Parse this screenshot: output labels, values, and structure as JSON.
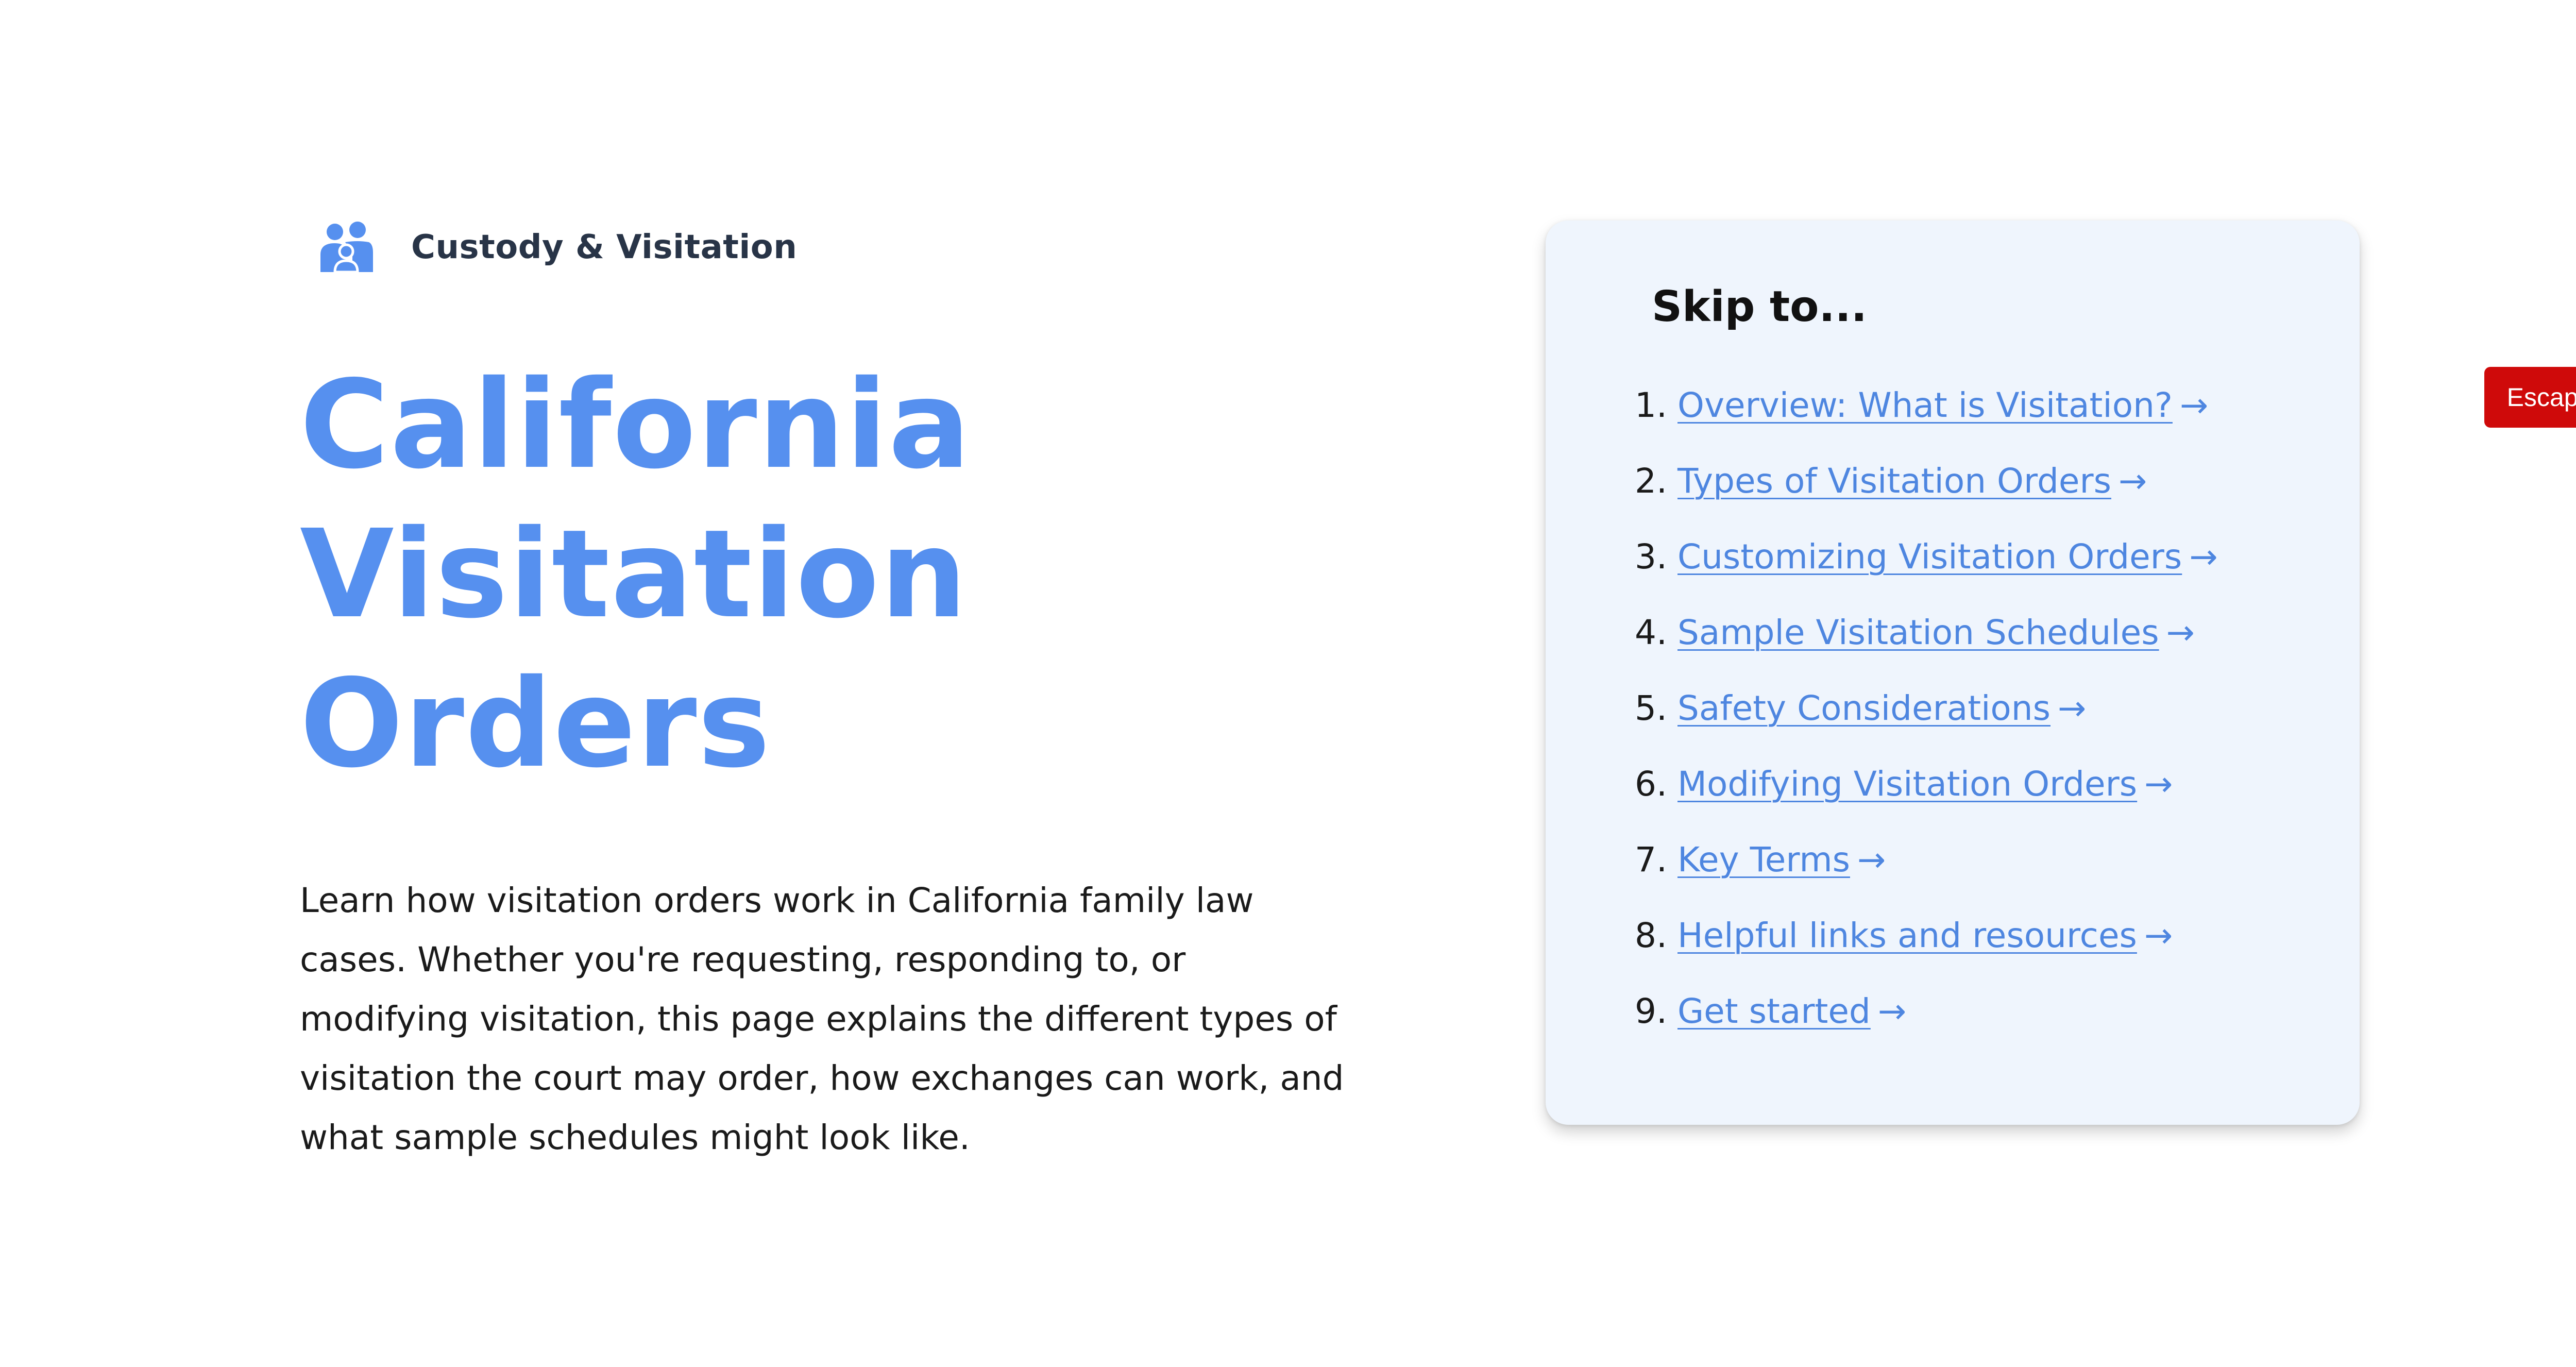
{
  "header": {
    "eyebrow_icon": "family-icon",
    "eyebrow_label": "Custody & Visitation",
    "title_line1": "California",
    "title_line2": "Visitation Orders",
    "lede": "Learn how visitation orders work in California family law cases. Whether you're requesting, responding to, or modifying visitation, this page explains the different types of visitation the court may order, how exchanges can work, and what sample schedules might look like."
  },
  "skip": {
    "heading": "Skip to...",
    "arrow": "→",
    "items": [
      {
        "num": "1.",
        "label": "Overview: What is Visitation?"
      },
      {
        "num": "2.",
        "label": "Types of Visitation Orders"
      },
      {
        "num": "3.",
        "label": "Customizing Visitation Orders"
      },
      {
        "num": "4.",
        "label": "Sample Visitation Schedules"
      },
      {
        "num": "5.",
        "label": "Safety Considerations"
      },
      {
        "num": "6.",
        "label": "Modifying Visitation Orders"
      },
      {
        "num": "7.",
        "label": "Key Terms"
      },
      {
        "num": "8.",
        "label": "Helpful links and resources"
      },
      {
        "num": "9.",
        "label": "Get started"
      }
    ]
  },
  "escape": {
    "label": "Escape"
  },
  "colors": {
    "accent": "#5690ef",
    "link": "#4e86e0",
    "card_bg": "#eff5fd",
    "escape_bg": "#cf0a0a"
  }
}
